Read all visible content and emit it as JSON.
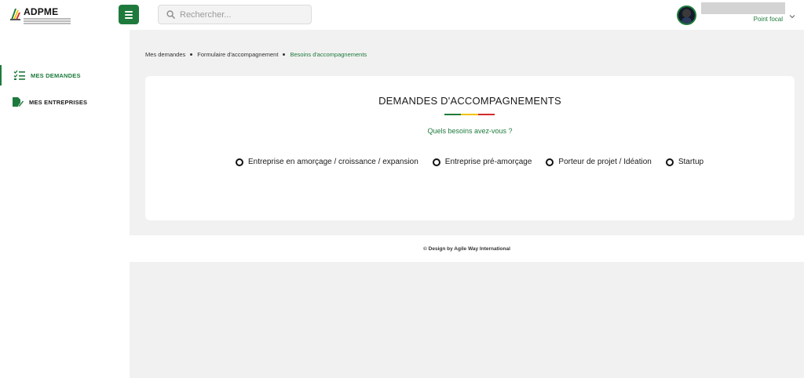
{
  "header": {
    "logo_title": "ADPME",
    "search_placeholder": "Rechercher...",
    "user_role": "Point focal"
  },
  "sidebar": {
    "items": [
      {
        "label": "MES DEMANDES",
        "icon": "checklist-icon",
        "active": true
      },
      {
        "label": "MES ENTREPRISES",
        "icon": "document-edit-icon",
        "active": false
      }
    ]
  },
  "breadcrumb": {
    "items": [
      "Mes demandes",
      "Formulaire d'accompagnement",
      "Besoins d'accompagnements"
    ]
  },
  "card": {
    "title": "DEMANDES D'ACCOMPAGNEMENTS",
    "question": "Quels besoins avez-vous ?",
    "options": [
      "Entreprise en amorçage / croissance / expansion",
      "Entreprise pré-amorçage",
      "Porteur de projet / Idéation",
      "Startup"
    ]
  },
  "footer": {
    "text": "© Design by Agile Way International"
  },
  "colors": {
    "primary": "#1e7a3c",
    "flag_green": "#1e7a3c",
    "flag_yellow": "#f2c200",
    "flag_red": "#d42a2a",
    "main_bg": "#f1f1f1"
  }
}
